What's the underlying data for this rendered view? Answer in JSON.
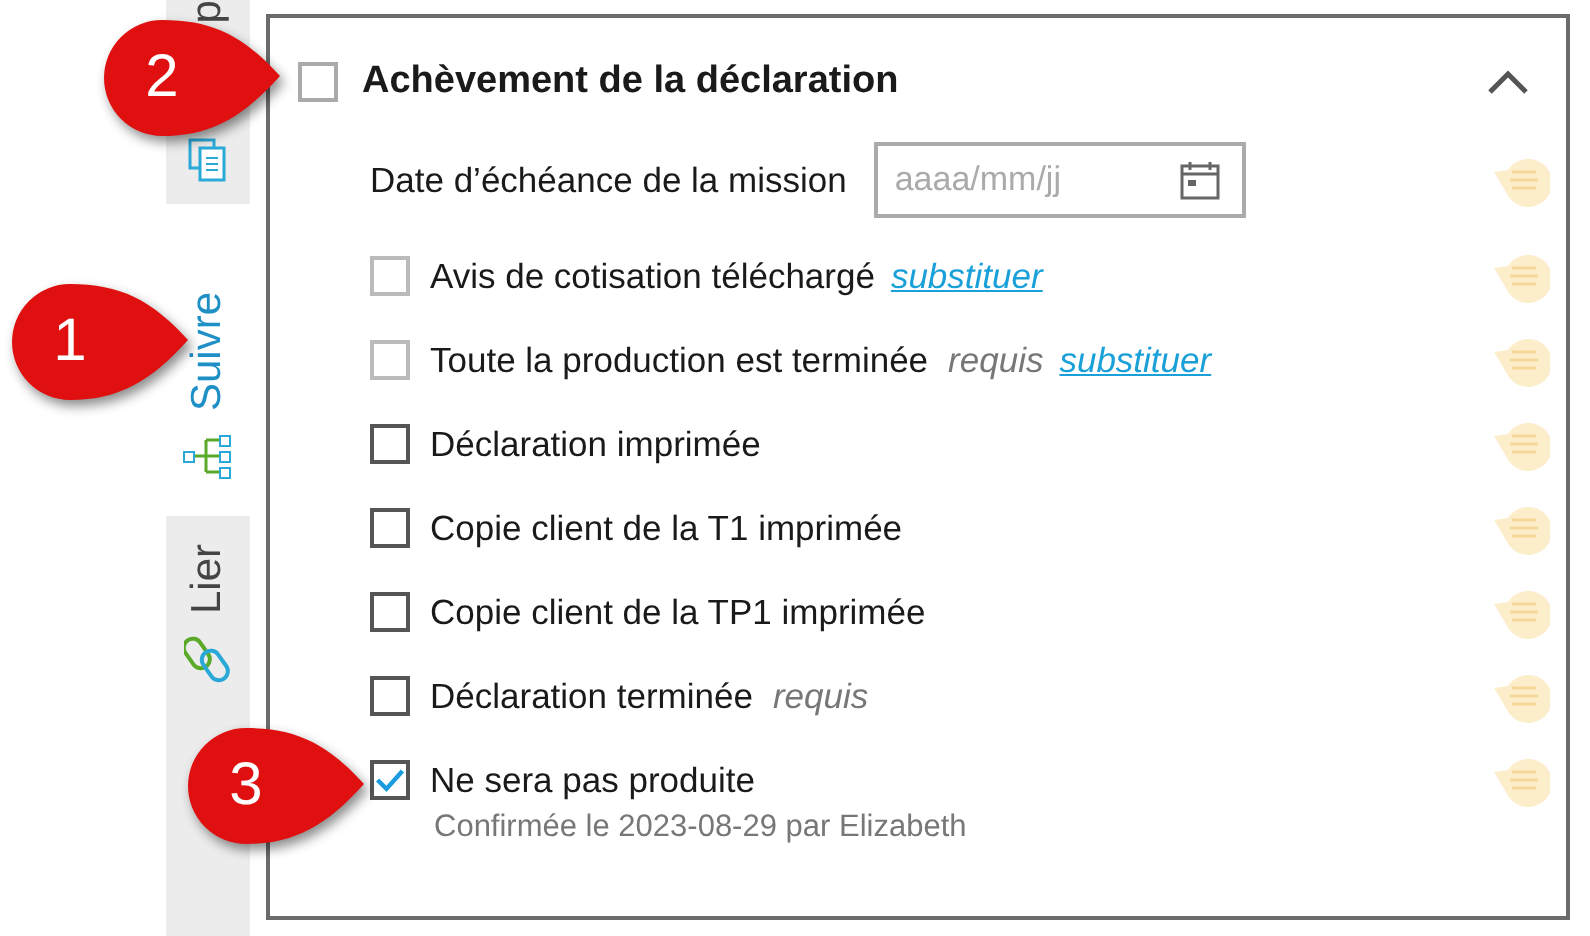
{
  "sidebar": {
    "tabs": [
      {
        "label": "p",
        "selected": false
      },
      {
        "label": "Suivre",
        "selected": true
      },
      {
        "label": "Lier",
        "selected": false
      }
    ]
  },
  "section": {
    "title": "Achèvement de la déclaration",
    "checked": false,
    "expanded": true,
    "items": [
      {
        "kind": "date",
        "label": "Date d’échéance de la mission",
        "placeholder": "aaaa/mm/jj"
      },
      {
        "kind": "check",
        "label": "Avis de cotisation téléchargé",
        "checked": false,
        "disabled": true,
        "link": "substituer"
      },
      {
        "kind": "check",
        "label": "Toute la production est terminée",
        "checked": false,
        "disabled": true,
        "note": "requis",
        "link": "substituer"
      },
      {
        "kind": "check",
        "label": "Déclaration imprimée",
        "checked": false,
        "disabled": false
      },
      {
        "kind": "check",
        "label": "Copie client de la T1 imprimée",
        "checked": false,
        "disabled": false
      },
      {
        "kind": "check",
        "label": "Copie client de la TP1 imprimée",
        "checked": false,
        "disabled": false
      },
      {
        "kind": "check",
        "label": "Déclaration terminée",
        "checked": false,
        "disabled": false,
        "note": "requis"
      },
      {
        "kind": "check",
        "label": "Ne sera pas produite",
        "checked": true,
        "disabled": false,
        "confirmation": "Confirmée le 2023-08-29 par Elizabeth"
      }
    ]
  },
  "callouts": [
    "1",
    "2",
    "3"
  ]
}
